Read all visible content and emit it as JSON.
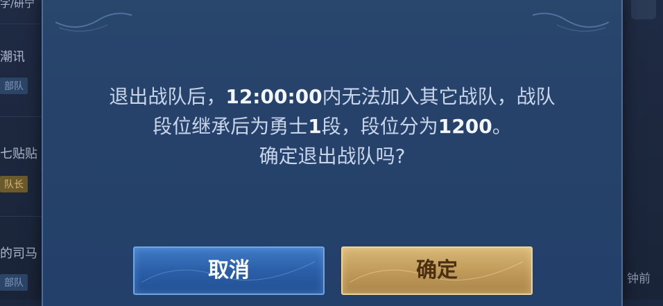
{
  "background": {
    "left_items": [
      {
        "name_text": "字/研宁",
        "tag": null
      },
      {
        "name_text": "潮讯",
        "tag": "部队"
      },
      {
        "name_text": "七贴贴",
        "tag": "队长"
      },
      {
        "name_text": "的司马",
        "tag": "部队"
      }
    ],
    "right_text": "钟前"
  },
  "dialog": {
    "message_line1_a": "退出战队后，",
    "message_line1_b": "12:00:00",
    "message_line1_c": "内无法加入其它战队，战队",
    "message_line2_a": "段位继承后为勇士",
    "message_line2_b": "1",
    "message_line2_c": "段，段位分为",
    "message_line2_d": "1200",
    "message_line2_e": "。",
    "message_line3": "确定退出战队吗?",
    "cancel_label": "取消",
    "confirm_label": "确定"
  },
  "colors": {
    "dialog_bg": "#26426a",
    "cancel_button": "#2a5fa8",
    "confirm_button": "#c19b5a"
  }
}
